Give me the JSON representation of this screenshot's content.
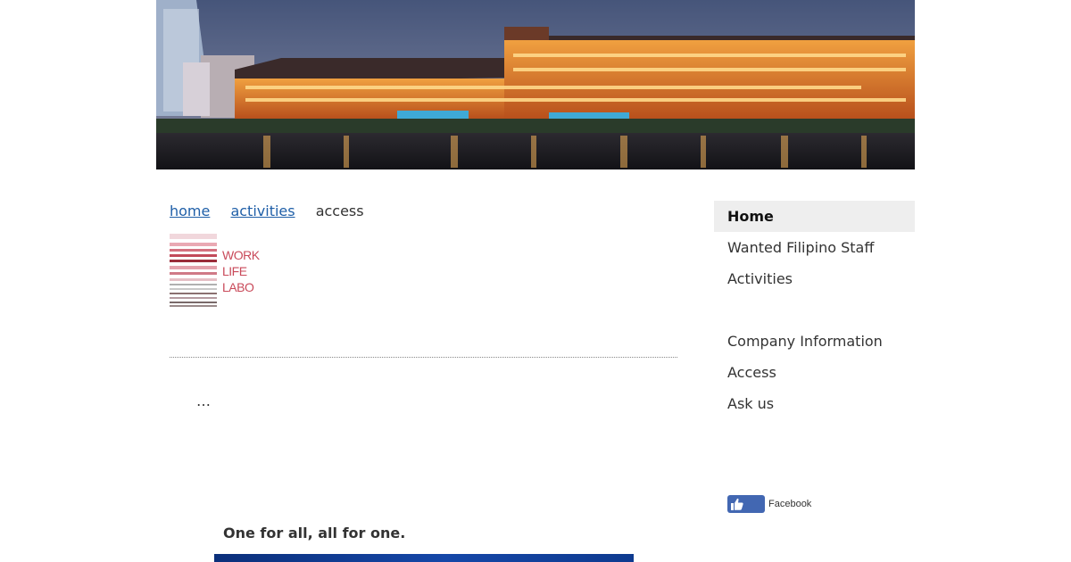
{
  "breadcrumb": {
    "home": "home",
    "activities": "activities",
    "current": "access"
  },
  "logo": {
    "line1": "WORK",
    "line2": "LIFE",
    "line3": "LABO"
  },
  "content": {
    "ellipsis": "…",
    "tagline": "One for all, all for one."
  },
  "sidebar": {
    "items": [
      {
        "label": "Home",
        "active": true
      },
      {
        "label": "Wanted Filipino Staff"
      },
      {
        "label": "Activities"
      },
      {
        "label": "Company Information"
      },
      {
        "label": "Access"
      },
      {
        "label": "Ask us"
      }
    ]
  },
  "facebook": {
    "label": "Facebook",
    "icon": "thumbs-up-icon",
    "color": "#4267b2"
  },
  "colors": {
    "link": "#1f5fa8",
    "logo_text": "#c94a5a",
    "nav_active_bg": "#eeeeee"
  }
}
